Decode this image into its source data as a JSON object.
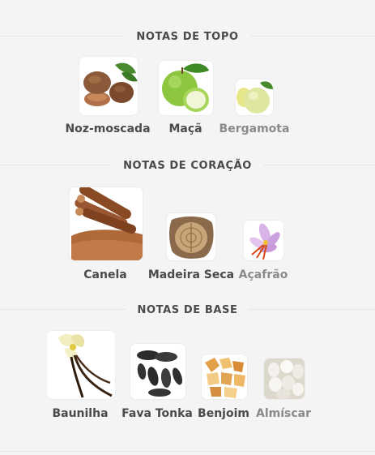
{
  "sections": [
    {
      "title": "NOTAS DE TOPO",
      "notes": [
        {
          "name": "Noz-moscada",
          "icon": "nutmeg-icon"
        },
        {
          "name": "Maçã",
          "icon": "apple-icon"
        },
        {
          "name": "Bergamota",
          "icon": "bergamot-icon"
        }
      ]
    },
    {
      "title": "NOTAS DE CORAÇÃO",
      "notes": [
        {
          "name": "Canela",
          "icon": "cinnamon-icon"
        },
        {
          "name": "Madeira Seca",
          "icon": "dry-wood-icon"
        },
        {
          "name": "Açafrão",
          "icon": "saffron-icon"
        }
      ]
    },
    {
      "title": "NOTAS DE BASE",
      "notes": [
        {
          "name": "Baunilha",
          "icon": "vanilla-icon"
        },
        {
          "name": "Fava Tonka",
          "icon": "tonka-bean-icon"
        },
        {
          "name": "Benjoim",
          "icon": "benzoin-icon"
        },
        {
          "name": "Almíscar",
          "icon": "musk-icon"
        }
      ]
    }
  ]
}
